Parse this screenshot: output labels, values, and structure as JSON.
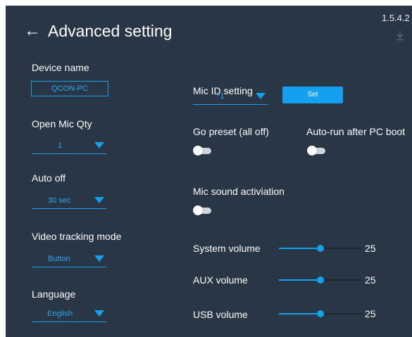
{
  "header": {
    "title": "Advanced setting",
    "version": "1.5.4.2"
  },
  "device": {
    "label": "Device name",
    "value": "QCON-PC"
  },
  "open_mic": {
    "label": "Open Mic Qty",
    "value": "1"
  },
  "auto_off": {
    "label": "Auto off",
    "value": "30 sec"
  },
  "video_tracking": {
    "label": "Video tracking mode",
    "value": "Button"
  },
  "language": {
    "label": "Language",
    "value": "English"
  },
  "mic_id": {
    "label": "Mic ID setting",
    "value": "*1",
    "set_label": "Set"
  },
  "go_preset": {
    "label": "Go preset (all off)",
    "on": false
  },
  "auto_run": {
    "label": "Auto-run after PC boot",
    "on": false
  },
  "mic_sound": {
    "label": "Mic sound activiation",
    "on": false
  },
  "volumes": {
    "system": {
      "label": "System volume",
      "value": "25",
      "fraction": 0.5
    },
    "aux": {
      "label": "AUX volume",
      "value": "25",
      "fraction": 0.5
    },
    "usb": {
      "label": "USB volume",
      "value": "25",
      "fraction": 0.5
    }
  },
  "colors": {
    "panel_bg": "#283646",
    "accent": "#14a0f0"
  },
  "icons": {
    "back": "arrow-left-icon",
    "download": "download-icon",
    "dropdown": "triangle-down-icon"
  }
}
